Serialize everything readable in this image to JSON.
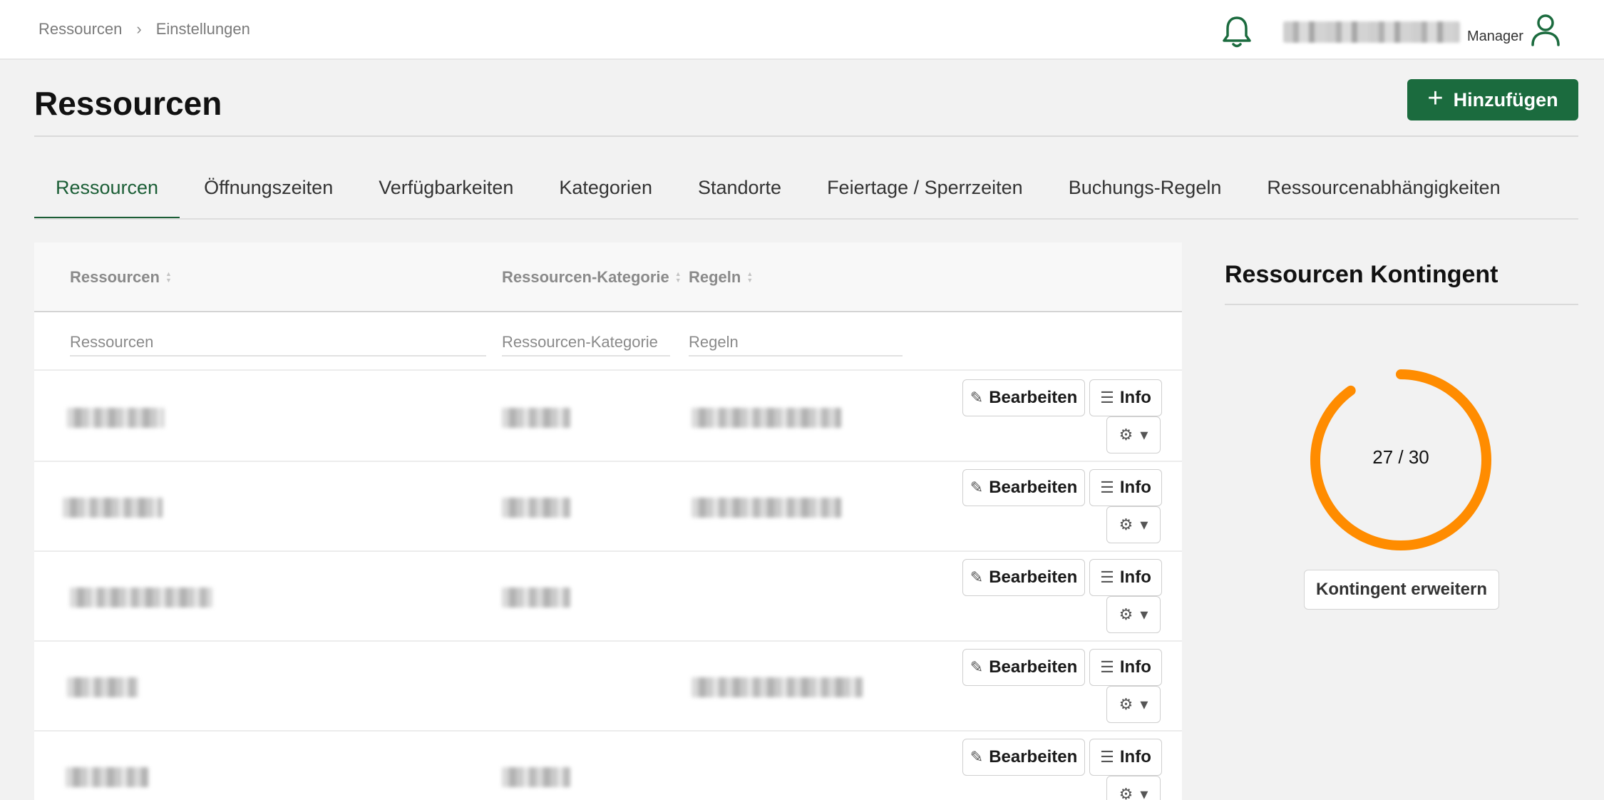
{
  "breadcrumb": {
    "items": [
      "Ressourcen",
      "Einstellungen"
    ],
    "separator": "›"
  },
  "user": {
    "role": "Manager"
  },
  "page": {
    "title": "Ressourcen",
    "add_label": "Hinzufügen"
  },
  "tabs": [
    {
      "label": "Ressourcen",
      "active": true
    },
    {
      "label": "Öffnungszeiten"
    },
    {
      "label": "Verfügbarkeiten"
    },
    {
      "label": "Kategorien"
    },
    {
      "label": "Standorte"
    },
    {
      "label": "Feiertage / Sperrzeiten"
    },
    {
      "label": "Buchungs-Regeln"
    },
    {
      "label": "Ressourcenabhängigkeiten"
    }
  ],
  "table": {
    "columns": [
      "Ressourcen",
      "Ressourcen-Kategorie",
      "Regeln"
    ],
    "filters": [
      "Ressourcen",
      "Ressourcen-Kategorie",
      "Regeln"
    ],
    "edit_label": "Bearbeiten",
    "info_label": "Info"
  },
  "quota": {
    "title": "Ressourcen Kontingent",
    "used": 27,
    "total": 30,
    "label": "27 / 30",
    "expand_label": "Kontingent erweitern",
    "color": "#ff8c00"
  },
  "colors": {
    "brand": "#1b6b3e",
    "tab_active": "#1b5e36"
  }
}
